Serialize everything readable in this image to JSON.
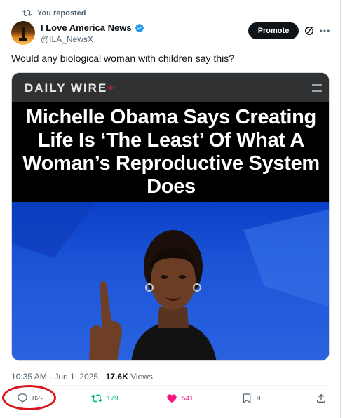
{
  "repost_label": "You reposted",
  "author": {
    "name": "I Love America News",
    "handle": "@ILA_NewsX"
  },
  "promote_label": "Promote",
  "tweet_text": "Would any biological woman with children say this?",
  "media": {
    "brand": "DAILY WIRE",
    "brand_plus": "+",
    "headline": "Michelle Obama Says Creating Life Is ‘The Least’ Of What A Woman’s Reproductive System Does"
  },
  "meta": {
    "time": "10:35 AM · Jun 1, 2025 · ",
    "views_count": "17.6K",
    "views_label": " Views"
  },
  "actions": {
    "replies": "822",
    "reposts": "179",
    "likes": "541",
    "bookmarks": "9"
  },
  "colors": {
    "repost_green": "#00ba7c",
    "like_pink": "#f91880",
    "verified_blue": "#1d9bf0",
    "annotation_red": "#d9141b",
    "dw_red": "#e2262f"
  },
  "icons": [
    "repost-icon",
    "verified-icon",
    "grok-icon",
    "more-icon",
    "menu-icon",
    "reply-icon",
    "like-icon",
    "bookmark-icon",
    "share-icon"
  ]
}
